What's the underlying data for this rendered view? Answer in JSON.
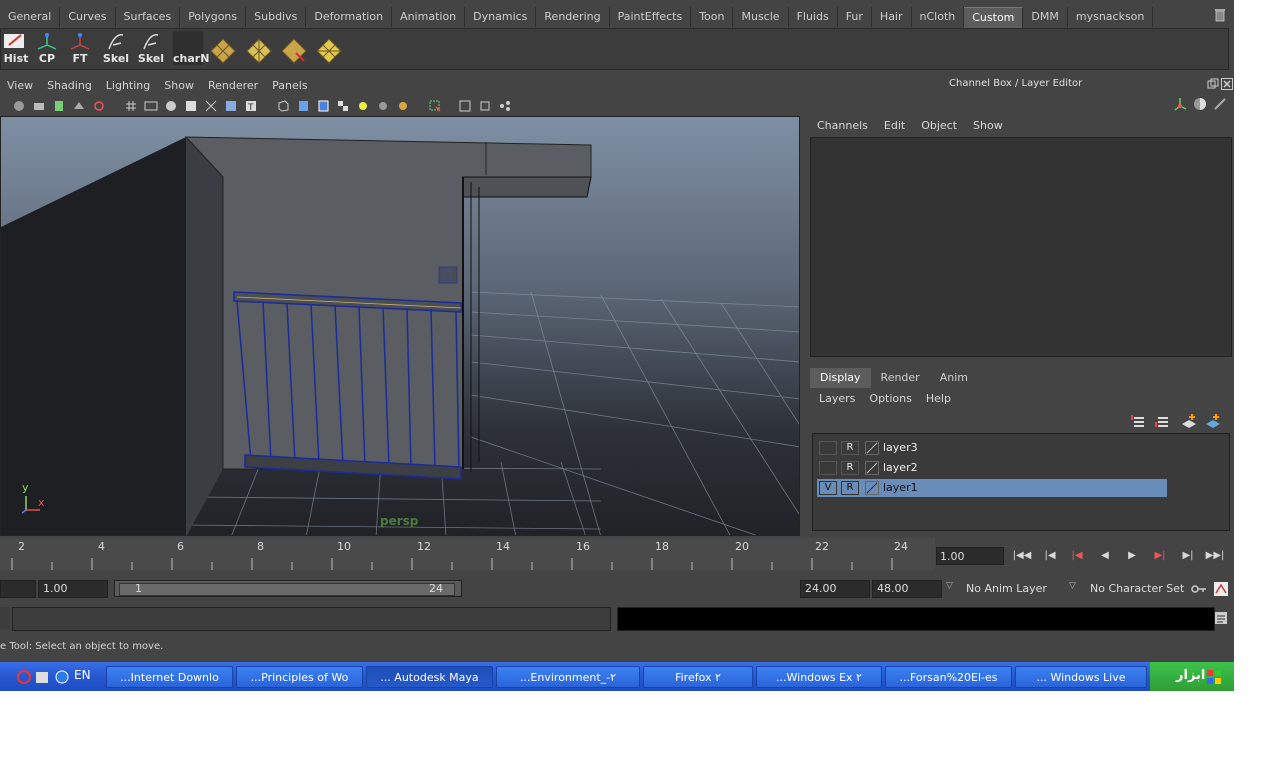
{
  "shelf_tabs": [
    "General",
    "Curves",
    "Surfaces",
    "Polygons",
    "Subdivs",
    "Deformation",
    "Animation",
    "Dynamics",
    "Rendering",
    "PaintEffects",
    "Toon",
    "Muscle",
    "Fluids",
    "Fur",
    "Hair",
    "nCloth",
    "Custom",
    "DMM",
    "mysnackson"
  ],
  "shelf_active": "Custom",
  "shelf_buttons": [
    "Hist",
    "CP",
    "FT",
    "Skel",
    "Skel",
    "charN"
  ],
  "viewport_menu": [
    "View",
    "Shading",
    "Lighting",
    "Show",
    "Renderer",
    "Panels"
  ],
  "viewport_camera": "persp",
  "axis_labels": {
    "y": "y",
    "x": "x"
  },
  "channel_box": {
    "title": "Channel Box / Layer Editor",
    "menu": [
      "Channels",
      "Edit",
      "Object",
      "Show"
    ]
  },
  "layer_editor": {
    "tabs": [
      "Display",
      "Render",
      "Anim"
    ],
    "active_tab": "Display",
    "menu": [
      "Layers",
      "Options",
      "Help"
    ],
    "layers": [
      {
        "v": "",
        "r": "R",
        "name": "layer3",
        "selected": false
      },
      {
        "v": "",
        "r": "R",
        "name": "layer2",
        "selected": false
      },
      {
        "v": "V",
        "r": "R",
        "name": "layer1",
        "selected": true
      }
    ]
  },
  "timeline": {
    "ticks": [
      "2",
      "4",
      "6",
      "8",
      "10",
      "12",
      "14",
      "16",
      "18",
      "20",
      "22",
      "24"
    ],
    "current_frame": "1.00"
  },
  "range": {
    "start_field": "1.00",
    "range_start": "1",
    "range_end": "24",
    "end_time": "24.00",
    "end_field": "48.00",
    "anim_layer": "No Anim Layer",
    "character_set": "No Character Set"
  },
  "helpline": "e Tool: Select an object to move.",
  "taskbar": {
    "lang": "EN",
    "buttons": [
      {
        "label": "...Internet Downlo",
        "active": false
      },
      {
        "label": "...Principles of Wo",
        "active": false
      },
      {
        "label": "... Autodesk Maya",
        "active": true
      },
      {
        "label": "...Environment_-۲",
        "active": false
      },
      {
        "label": "Firefox ۲",
        "active": false
      },
      {
        "label": "...Windows Ex ۲",
        "active": false
      },
      {
        "label": "...Forsan%20El-es",
        "active": false
      },
      {
        "label": "... Windows Live",
        "active": false
      }
    ],
    "tray_text": "ابزار"
  },
  "colors": {
    "app_bg": "#444444",
    "selection": "#6a8cb8",
    "taskbar": "#2658d0",
    "tray": "#3ec24a"
  }
}
